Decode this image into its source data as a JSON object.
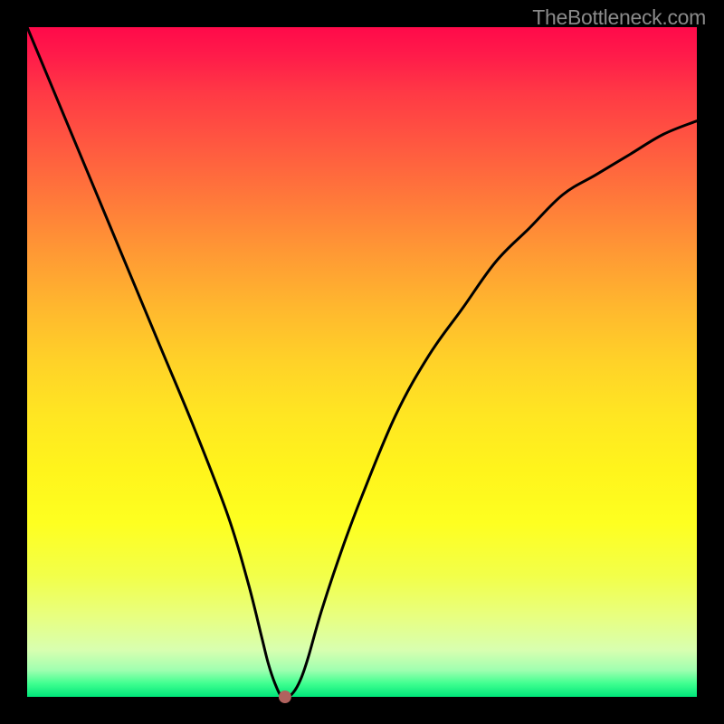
{
  "watermark": "TheBottleneck.com",
  "chart_data": {
    "type": "line",
    "title": "",
    "xlabel": "",
    "ylabel": "",
    "xlim": [
      0,
      100
    ],
    "ylim": [
      0,
      100
    ],
    "grid": false,
    "series": [
      {
        "name": "curve",
        "x": [
          0,
          5,
          10,
          15,
          20,
          25,
          30,
          33,
          35,
          36,
          37,
          38,
          39,
          40,
          41,
          42,
          44,
          47,
          50,
          55,
          60,
          65,
          70,
          75,
          80,
          85,
          90,
          95,
          100
        ],
        "y": [
          100,
          88,
          76,
          64,
          52,
          40,
          27,
          17,
          9,
          5,
          2,
          0,
          0,
          1,
          3,
          6,
          13,
          22,
          30,
          42,
          51,
          58,
          65,
          70,
          75,
          78,
          81,
          84,
          86
        ]
      }
    ],
    "marker": {
      "x": 38.5,
      "y": 0,
      "color": "#b0625e"
    }
  }
}
